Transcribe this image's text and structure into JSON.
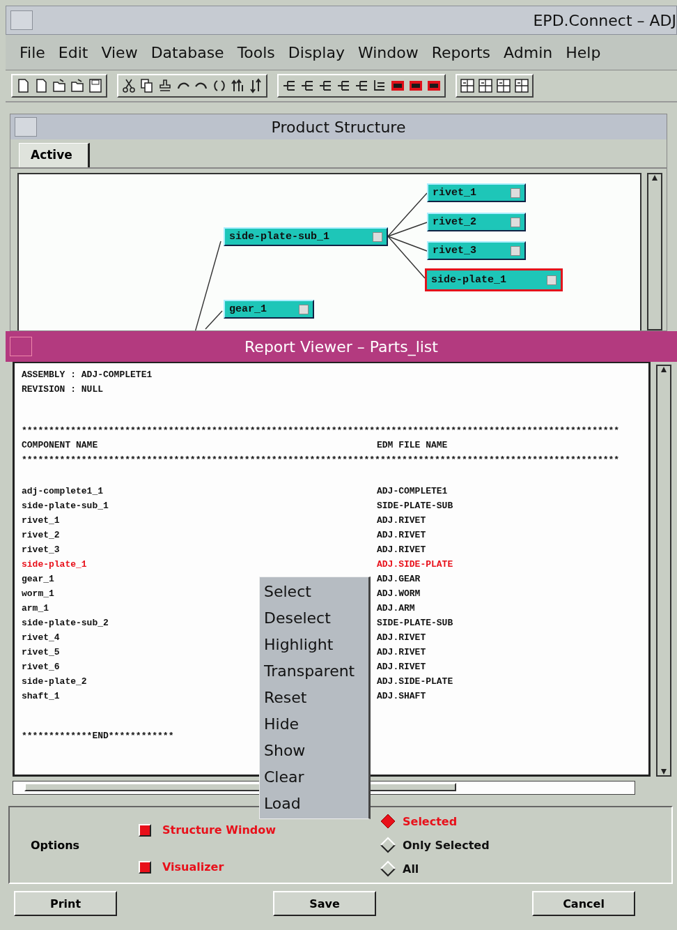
{
  "window": {
    "title": "EPD.Connect – ADJ"
  },
  "menu": [
    "File",
    "Edit",
    "View",
    "Database",
    "Tools",
    "Display",
    "Window",
    "Reports",
    "Admin",
    "Help"
  ],
  "product_structure": {
    "title": "Product Structure",
    "tabs": [
      {
        "label": "Active",
        "selected": true
      }
    ],
    "tree": [
      {
        "label": "side-plate-sub_1",
        "selected": false,
        "children": [
          {
            "label": "rivet_1",
            "selected": false
          },
          {
            "label": "rivet_2",
            "selected": false
          },
          {
            "label": "rivet_3",
            "selected": false
          },
          {
            "label": "side-plate_1",
            "selected": true
          }
        ]
      },
      {
        "label": "gear_1",
        "selected": false
      }
    ]
  },
  "report_viewer": {
    "title": "Report Viewer – Parts_list",
    "header": [
      "ASSEMBLY : ADJ-COMPLETE1",
      "REVISION : NULL"
    ],
    "rule": "**************************************************************************************************************",
    "columns": [
      "COMPONENT NAME",
      "EDM FILE NAME"
    ],
    "rows": [
      {
        "component": "adj-complete1_1",
        "file": "ADJ-COMPLETE1",
        "selected": false
      },
      {
        "component": "side-plate-sub_1",
        "file": "SIDE-PLATE-SUB",
        "selected": false
      },
      {
        "component": "rivet_1",
        "file": "ADJ.RIVET",
        "selected": false
      },
      {
        "component": "rivet_2",
        "file": "ADJ.RIVET",
        "selected": false
      },
      {
        "component": "rivet_3",
        "file": "ADJ.RIVET",
        "selected": false
      },
      {
        "component": "side-plate_1",
        "file": "ADJ.SIDE-PLATE",
        "selected": true
      },
      {
        "component": "gear_1",
        "file": "ADJ.GEAR",
        "selected": false
      },
      {
        "component": "worm_1",
        "file": "ADJ.WORM",
        "selected": false
      },
      {
        "component": "arm_1",
        "file": "ADJ.ARM",
        "selected": false
      },
      {
        "component": "side-plate-sub_2",
        "file": "SIDE-PLATE-SUB",
        "selected": false
      },
      {
        "component": "rivet_4",
        "file": "ADJ.RIVET",
        "selected": false
      },
      {
        "component": "rivet_5",
        "file": "ADJ.RIVET",
        "selected": false
      },
      {
        "component": "rivet_6",
        "file": "ADJ.RIVET",
        "selected": false
      },
      {
        "component": "side-plate_2",
        "file": "ADJ.SIDE-PLATE",
        "selected": false
      },
      {
        "component": "shaft_1",
        "file": "ADJ.SHAFT",
        "selected": false
      }
    ],
    "footer": "*************END************",
    "context_menu": [
      "Select",
      "Deselect",
      "Highlight",
      "Transparent",
      "Reset",
      "Hide",
      "Show",
      "Clear",
      "Load"
    ],
    "options": {
      "label": "Options",
      "checkboxes": [
        {
          "label": "Structure Window",
          "checked": true
        },
        {
          "label": "Visualizer",
          "checked": true
        }
      ],
      "radios": [
        {
          "label": "Selected",
          "selected": true
        },
        {
          "label": "Only Selected",
          "selected": false
        },
        {
          "label": "All",
          "selected": false
        }
      ]
    },
    "buttons": [
      "Print",
      "Save",
      "Cancel"
    ]
  }
}
